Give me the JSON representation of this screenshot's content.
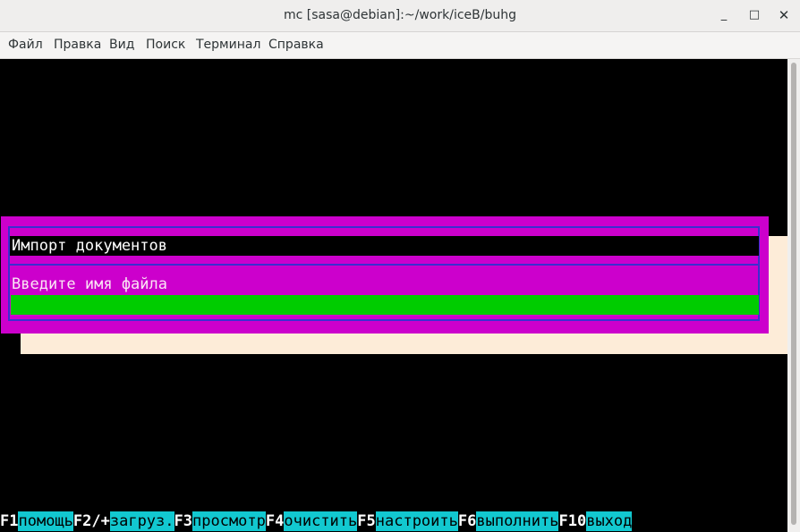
{
  "window": {
    "title": "mc [sasa@debian]:~/work/iceB/buhg",
    "minimize_glyph": "_",
    "maximize_glyph": "□",
    "close_glyph": "✕"
  },
  "menubar": {
    "items": [
      {
        "label": "Файл"
      },
      {
        "label": "Правка"
      },
      {
        "label": "Вид"
      },
      {
        "label": "Поиск"
      },
      {
        "label": "Терминал"
      },
      {
        "label": "Справка"
      }
    ]
  },
  "dialog": {
    "title": "Импорт документов",
    "prompt": "Введите имя файла",
    "input_value": ""
  },
  "fkeys": [
    {
      "key": "F1",
      "label": "помощь"
    },
    {
      "key": "F2/+",
      "label": "загруз."
    },
    {
      "key": "F3",
      "label": "просмотр"
    },
    {
      "key": "F4",
      "label": "очистить"
    },
    {
      "key": "F5",
      "label": "настроить"
    },
    {
      "key": "F6",
      "label": "выполнить"
    },
    {
      "key": "F10",
      "label": "выход"
    }
  ],
  "colors": {
    "dialog_bg": "#cc00cc",
    "frame": "#3a2fd0",
    "input_bg": "#00cc00",
    "shadow": "#fdecd8",
    "fkey_label_bg": "#12c8d0"
  }
}
